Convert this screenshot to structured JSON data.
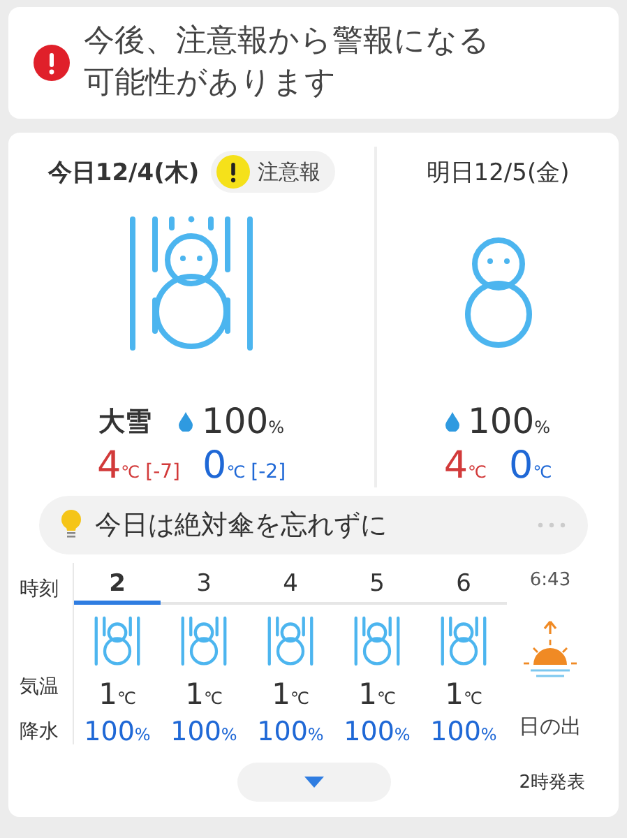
{
  "alert": {
    "text": "今後、注意報から警報になる可能性があります"
  },
  "days": [
    {
      "title": "今日12/4(木)",
      "badge": {
        "kind": "advisory",
        "label": "注意報"
      },
      "kind": "heavy-snow",
      "weather": "大雪",
      "precip": "100",
      "precip_unit": "%",
      "high": "4",
      "high_unit": "℃",
      "high_diff": "[-7]",
      "low": "0",
      "low_unit": "℃",
      "low_diff": "[-2]"
    },
    {
      "title": "明日12/5(金)",
      "kind": "snow",
      "precip": "100",
      "precip_unit": "%",
      "high": "4",
      "high_unit": "℃",
      "low": "0",
      "low_unit": "℃"
    }
  ],
  "tip": {
    "text": "今日は絶対傘を忘れずに"
  },
  "hourly": {
    "row_labels": [
      "時刻",
      "気温",
      "降水"
    ],
    "columns": [
      {
        "kind": "heavy-snow",
        "hour": "2",
        "selected": true,
        "temp": "1",
        "temp_unit": "℃",
        "precip": "100",
        "precip_unit": "%"
      },
      {
        "kind": "heavy-snow",
        "hour": "3",
        "selected": false,
        "temp": "1",
        "temp_unit": "℃",
        "precip": "100",
        "precip_unit": "%"
      },
      {
        "kind": "heavy-snow",
        "hour": "4",
        "selected": false,
        "temp": "1",
        "temp_unit": "℃",
        "precip": "100",
        "precip_unit": "%"
      },
      {
        "kind": "heavy-snow",
        "hour": "5",
        "selected": false,
        "temp": "1",
        "temp_unit": "℃",
        "precip": "100",
        "precip_unit": "%"
      },
      {
        "kind": "heavy-snow",
        "hour": "6",
        "selected": false,
        "temp": "1",
        "temp_unit": "℃",
        "precip": "100",
        "precip_unit": "%"
      },
      {
        "kind": "sunrise",
        "time": "6:43",
        "label": "日の出"
      }
    ]
  },
  "footer": {
    "issued": "2時発表"
  }
}
